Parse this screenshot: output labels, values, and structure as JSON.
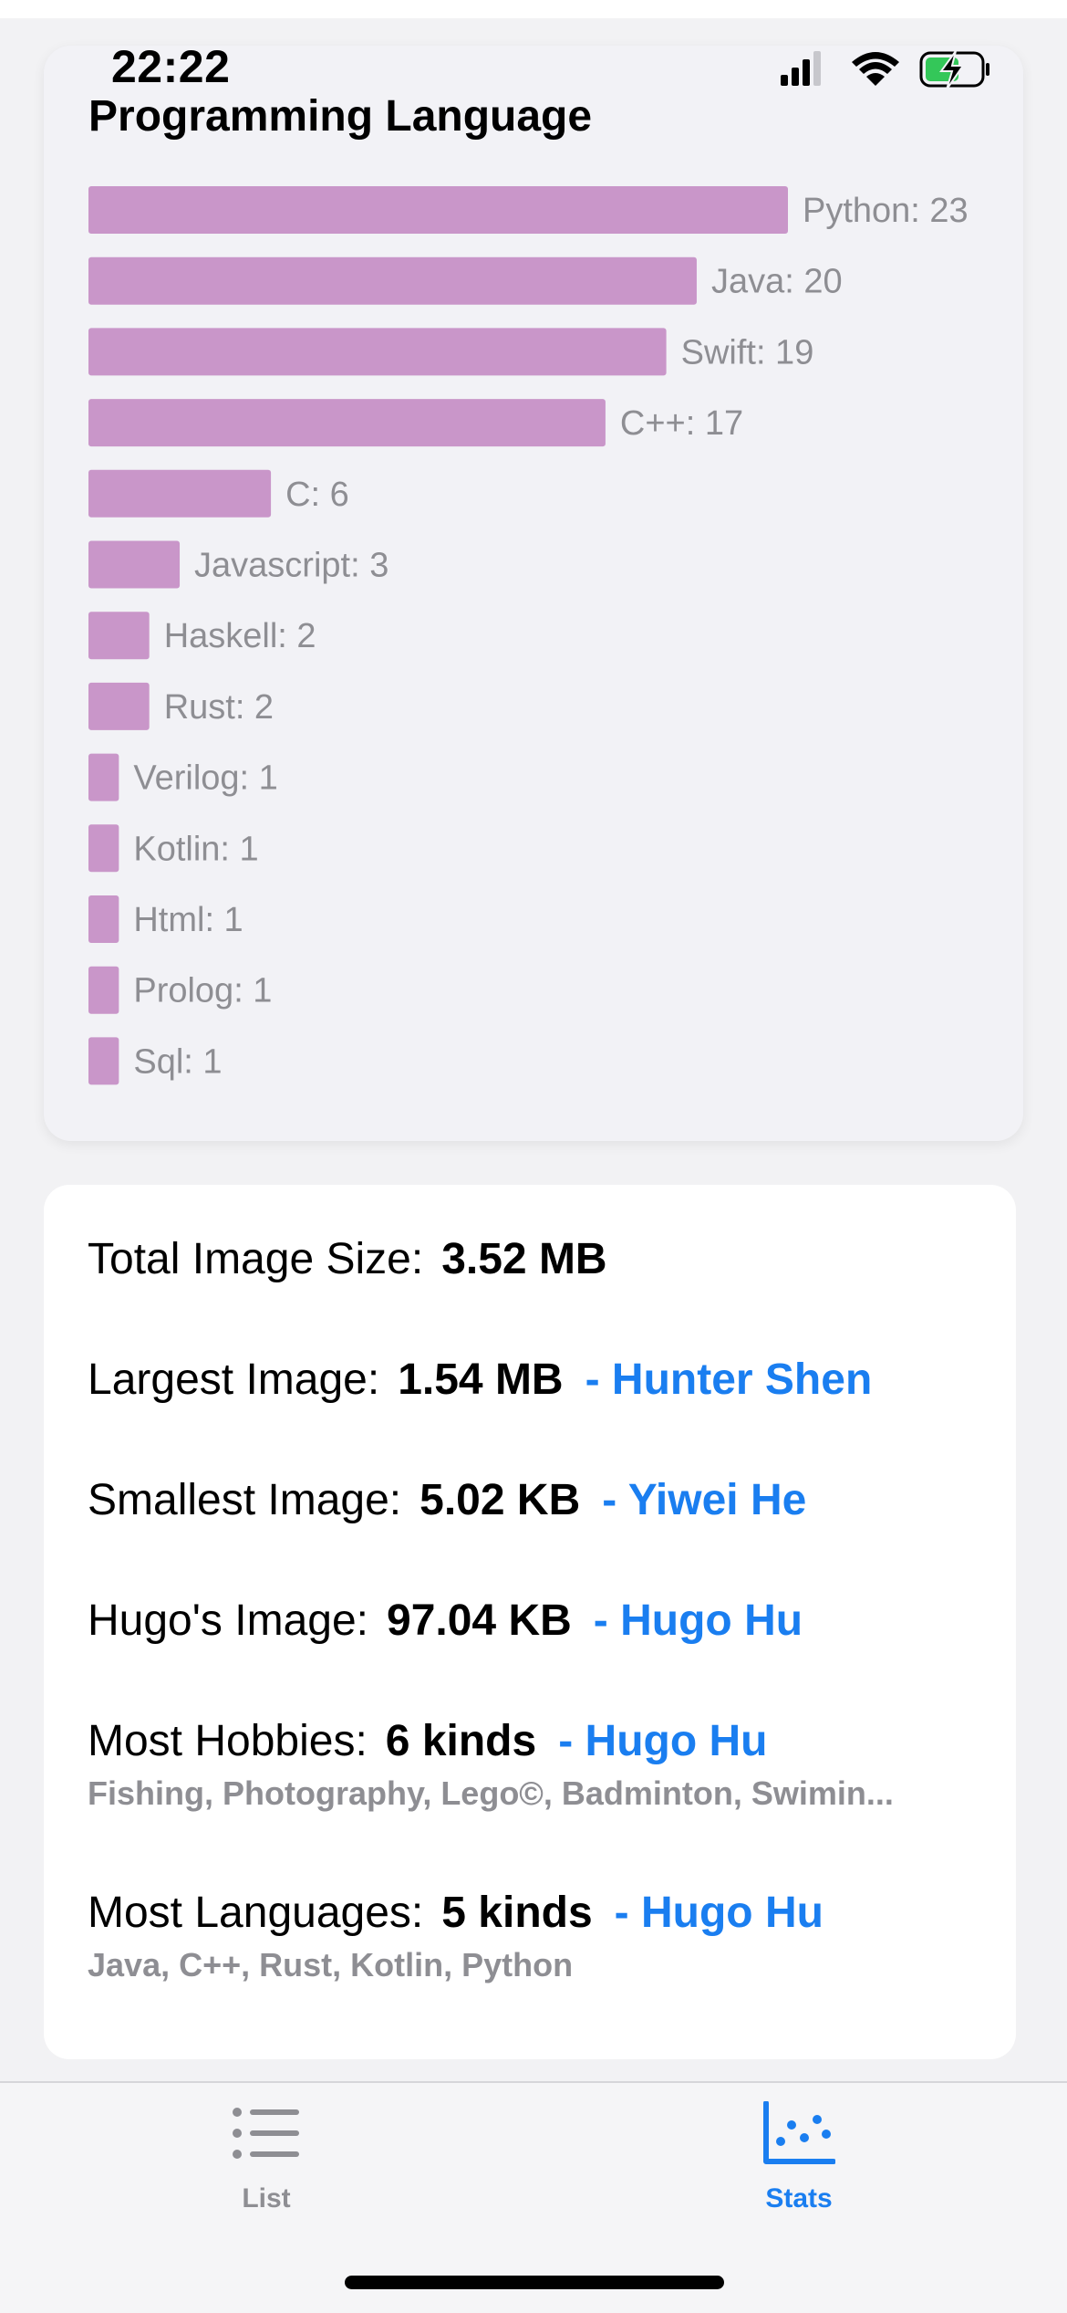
{
  "status_bar": {
    "time": "22:22"
  },
  "chart_data": {
    "type": "bar",
    "orientation": "horizontal",
    "title": "Programming Language",
    "categories": [
      "Python",
      "Java",
      "Swift",
      "C++",
      "C",
      "Javascript",
      "Haskell",
      "Rust",
      "Verilog",
      "Kotlin",
      "Html",
      "Prolog",
      "Sql"
    ],
    "values": [
      23,
      20,
      19,
      17,
      6,
      3,
      2,
      2,
      1,
      1,
      1,
      1,
      1
    ],
    "data_labels": [
      "Python: 23",
      "Java: 20",
      "Swift: 19",
      "C++: 17",
      "C: 6",
      "Javascript: 3",
      "Haskell: 2",
      "Rust: 2",
      "Verilog: 1",
      "Kotlin: 1",
      "Html: 1",
      "Prolog: 1",
      "Sql: 1"
    ],
    "bar_color": "#c996c9",
    "grid": false,
    "xlabel": "",
    "ylabel": ""
  },
  "stats": [
    {
      "label": "Total Image Size:",
      "value": "3.52 MB",
      "who": "",
      "sub": ""
    },
    {
      "label": "Largest Image:",
      "value": "1.54 MB",
      "who": "- Hunter Shen",
      "sub": ""
    },
    {
      "label": "Smallest Image:",
      "value": "5.02 KB",
      "who": "- Yiwei He",
      "sub": ""
    },
    {
      "label": "Hugo's Image:",
      "value": "97.04 KB",
      "who": "- Hugo Hu",
      "sub": ""
    },
    {
      "label": "Most Hobbies:",
      "value": "6 kinds",
      "who": "- Hugo Hu",
      "sub": "Fishing, Photography, Lego©, Badminton, Swimin..."
    },
    {
      "label": "Most Languages:",
      "value": "5 kinds",
      "who": "- Hugo Hu",
      "sub": "Java, C++, Rust, Kotlin, Python"
    }
  ],
  "tabs": [
    {
      "label": "List",
      "icon": "list-icon",
      "selected": false
    },
    {
      "label": "Stats",
      "icon": "chart-dots-icon",
      "selected": true
    }
  ],
  "colors": {
    "accent": "#1a7ef0",
    "inactive": "#8e8e93",
    "bar": "#c996c9",
    "battery": "#34c759"
  }
}
